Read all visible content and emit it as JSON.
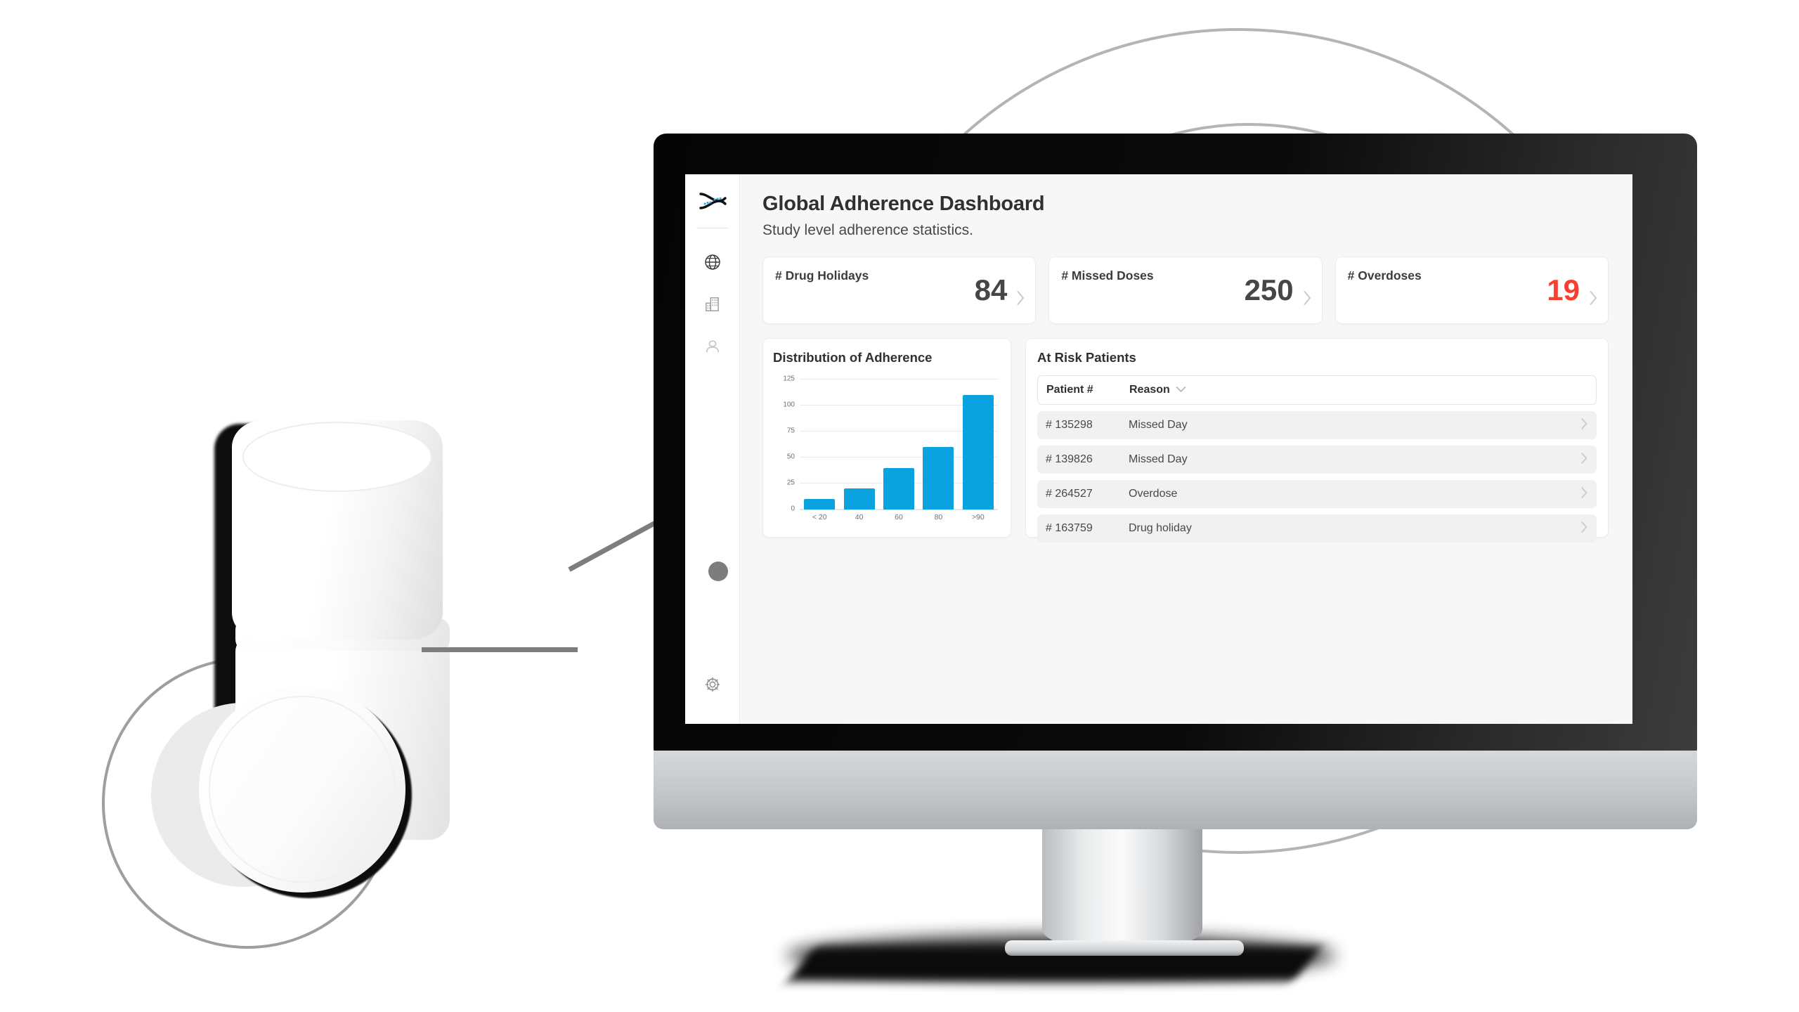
{
  "app": {
    "title": "Global Adherence Dashboard",
    "subtitle": "Study level adherence statistics."
  },
  "sidebar": {
    "logo_name": "dna-helix-logo",
    "items": [
      {
        "name": "globe-icon",
        "label": "Global"
      },
      {
        "name": "building-icon",
        "label": "Sites"
      },
      {
        "name": "person-icon",
        "label": "Patients"
      }
    ],
    "footer_item": {
      "name": "gear-icon",
      "label": "Settings"
    }
  },
  "stats": [
    {
      "label": "# Drug Holidays",
      "value": "84",
      "danger": false
    },
    {
      "label": "# Missed Doses",
      "value": "250",
      "danger": false
    },
    {
      "label": "# Overdoses",
      "value": "19",
      "danger": true
    }
  ],
  "chart_panel": {
    "title": "Distribution of Adherence"
  },
  "table_panel": {
    "title": "At Risk Patients",
    "columns": [
      "Patient #",
      "Reason"
    ],
    "sort_icon": "chevron-down-icon",
    "rows": [
      {
        "patient": "# 135298",
        "reason": "Missed Day"
      },
      {
        "patient": "# 139826",
        "reason": "Missed Day"
      },
      {
        "patient": "# 264527",
        "reason": "Overdose"
      },
      {
        "patient": "# 163759",
        "reason": "Drug holiday"
      }
    ]
  },
  "colors": {
    "bar_blue": "#0aa3e0",
    "danger_red": "#f93f2e",
    "panel_bg": "#ffffff",
    "app_bg": "#f7f7f8",
    "row_bg": "#f1f1f2"
  },
  "chart_data": {
    "type": "bar",
    "title": "Distribution of Adherence",
    "xlabel": "",
    "ylabel": "",
    "categories": [
      "< 20",
      "40",
      "60",
      "80",
      ">90"
    ],
    "values": [
      10,
      20,
      40,
      60,
      110
    ],
    "yticks": [
      0,
      25,
      50,
      75,
      100,
      125
    ],
    "ylim": [
      0,
      125
    ],
    "grid": true,
    "legend": "none",
    "series_color": "#0aa3e0"
  }
}
